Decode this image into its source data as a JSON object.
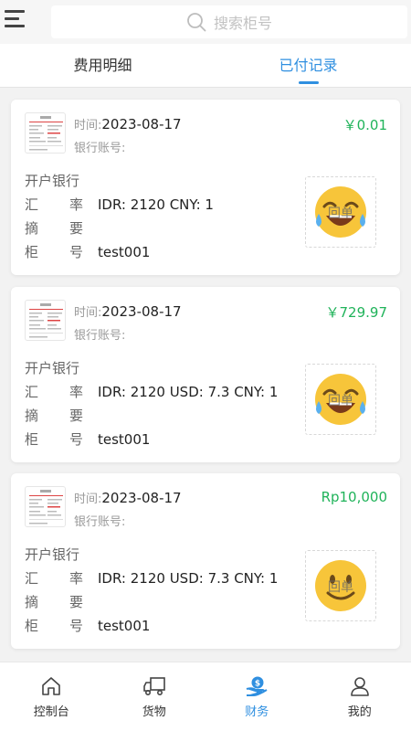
{
  "search": {
    "placeholder": "搜索柜号"
  },
  "tabs": [
    {
      "label": "费用明细",
      "active": false
    },
    {
      "label": "已付记录",
      "active": true
    }
  ],
  "labels": {
    "time": "时间:",
    "bank_account": "银行账号:",
    "bank_name": "开户银行",
    "rate_a": "汇",
    "rate_b": "率",
    "summary_a": "摘",
    "summary_b": "要",
    "container_a": "柜",
    "container_b": "号",
    "stamp_text": "回单"
  },
  "records": [
    {
      "time": "2023-08-17",
      "bank_account": "",
      "amount": "￥0.01",
      "bank_name": "",
      "rate": "IDR: 2120 CNY: 1",
      "summary": "",
      "container_no": "test001",
      "stamp_emoji": "laughing-tears"
    },
    {
      "time": "2023-08-17",
      "bank_account": "",
      "amount": "￥729.97",
      "bank_name": "",
      "rate": "IDR: 2120 USD: 7.3 CNY: 1",
      "summary": "",
      "container_no": "test001",
      "stamp_emoji": "laughing-tears"
    },
    {
      "time": "2023-08-17",
      "bank_account": "",
      "amount": "Rp10,000",
      "bank_name": "",
      "rate": "IDR: 2120 USD: 7.3 CNY: 1",
      "summary": "",
      "container_no": "test001",
      "stamp_emoji": "smile"
    }
  ],
  "bottom_nav": [
    {
      "label": "控制台",
      "icon": "home-icon",
      "active": false
    },
    {
      "label": "货物",
      "icon": "truck-icon",
      "active": false
    },
    {
      "label": "财务",
      "icon": "finance-icon",
      "active": true
    },
    {
      "label": "我的",
      "icon": "user-icon",
      "active": false
    }
  ],
  "colors": {
    "accent": "#2f8fe0",
    "amount": "#20b35a"
  }
}
